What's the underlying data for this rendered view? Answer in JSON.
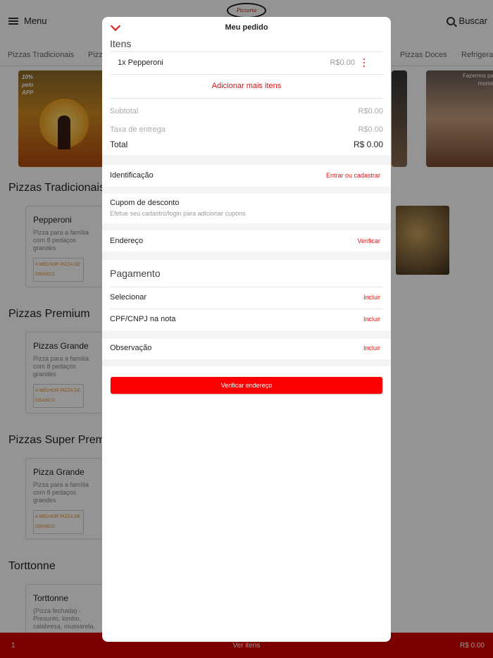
{
  "header": {
    "menu_label": "Menu",
    "search_label": "Buscar",
    "logo_text": "Pizzaria"
  },
  "categories": [
    "Pizzas Tradicionais",
    "Pizz",
    "Pizzas Doces",
    "Refrigera"
  ],
  "banners": {
    "promo_text": "10% pelo APP",
    "right_text": "Fazemos pa mome"
  },
  "sections": [
    {
      "title": "Pizzas Tradicionais",
      "card": {
        "name": "Pepperoni",
        "desc": "Pizza para a família com 8 pedaços grandes",
        "tag": "A MELHOR PIZZA DE OSASCO"
      }
    },
    {
      "title": "Pizzas Premium",
      "card": {
        "name": "Pizzas Grande",
        "desc": "Pizza para a família com 8 pedaços grandes",
        "tag": "A MELHOR PIZZA DE OSASCO"
      }
    },
    {
      "title": "Pizzas Super Prem",
      "card": {
        "name": "Pizza Grande",
        "desc": "Pizza para a família com 8 pedaços grandes",
        "tag": "A MELHOR PIZZA DE OSASCO"
      }
    },
    {
      "title": "Torttonne",
      "card": {
        "name": "Torttonne",
        "desc": "(Pizza fechada) - Presunto, lombo, calabresa, mussarela,",
        "tag": ""
      }
    }
  ],
  "bottom_bar": {
    "quantity": "1",
    "label": "Ver itens",
    "amount": "R$ 0.00"
  },
  "modal": {
    "title": "Meu pedido",
    "items_label": "Itens",
    "items": [
      {
        "name": "1x Pepperoni",
        "price": "R$0.00"
      }
    ],
    "add_more": "Adicionar mais itens",
    "subtotal_label": "Subtotal",
    "subtotal_value": "R$0.00",
    "delivery_label": "Taxa de entrega",
    "delivery_value": "R$0.00",
    "total_label": "Total",
    "total_value": "R$ 0.00",
    "identification_label": "Identificação",
    "identification_action": "Entrar ou cadastrar",
    "coupon_label": "Cupom de desconto",
    "coupon_sub": "Efetue seu cadastro/login para adicionar cupons",
    "address_label": "Endereço",
    "address_action": "Verificar",
    "payment_title": "Pagamento",
    "payment_select_label": "Selecionar",
    "payment_select_action": "Incluir",
    "cpf_label": "CPF/CNPJ na nota",
    "cpf_action": "Incluir",
    "note_label": "Observação",
    "note_action": "Incluir",
    "cta_label": "Verificar endereço"
  },
  "colors": {
    "accent": "#e01010",
    "cta": "#fa0000",
    "bottom_bar": "#d40000"
  }
}
